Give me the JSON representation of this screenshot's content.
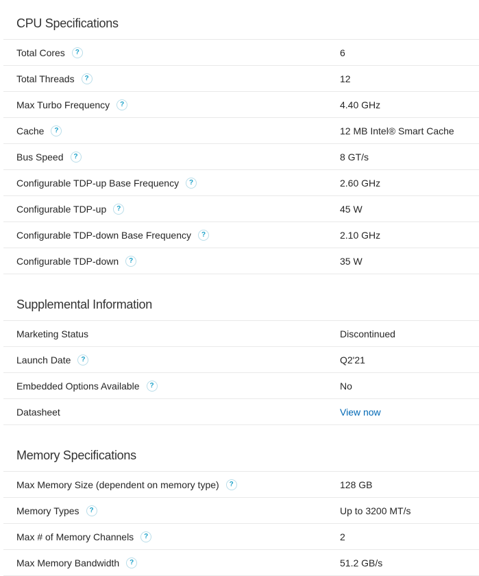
{
  "sections": [
    {
      "title": "CPU Specifications",
      "rows": [
        {
          "label": "Total Cores",
          "value": "6",
          "help": true
        },
        {
          "label": "Total Threads",
          "value": "12",
          "help": true
        },
        {
          "label": "Max Turbo Frequency",
          "value": "4.40 GHz",
          "help": true
        },
        {
          "label": "Cache",
          "value": "12 MB Intel® Smart Cache",
          "help": true
        },
        {
          "label": "Bus Speed",
          "value": "8 GT/s",
          "help": true
        },
        {
          "label": "Configurable TDP-up Base Frequency",
          "value": "2.60 GHz",
          "help": true
        },
        {
          "label": "Configurable TDP-up",
          "value": "45 W",
          "help": true
        },
        {
          "label": "Configurable TDP-down Base Frequency",
          "value": "2.10 GHz",
          "help": true
        },
        {
          "label": "Configurable TDP-down",
          "value": "35 W",
          "help": true
        }
      ]
    },
    {
      "title": "Supplemental Information",
      "rows": [
        {
          "label": "Marketing Status",
          "value": "Discontinued",
          "help": false
        },
        {
          "label": "Launch Date",
          "value": "Q2'21",
          "help": true
        },
        {
          "label": "Embedded Options Available",
          "value": "No",
          "help": true
        },
        {
          "label": "Datasheet",
          "value": "View now",
          "help": false,
          "link": true
        }
      ]
    },
    {
      "title": "Memory Specifications",
      "rows": [
        {
          "label": "Max Memory Size (dependent on memory type)",
          "value": "128 GB",
          "help": true
        },
        {
          "label": "Memory Types",
          "value": "Up to 3200 MT/s",
          "help": true
        },
        {
          "label": "Max # of Memory Channels",
          "value": "2",
          "help": true
        },
        {
          "label": "Max Memory Bandwidth",
          "value": "51.2 GB/s",
          "help": true
        }
      ]
    }
  ],
  "help_icon_glyph": "?",
  "colors": {
    "link": "#0068b5",
    "help_icon": "#1ba1c9"
  }
}
